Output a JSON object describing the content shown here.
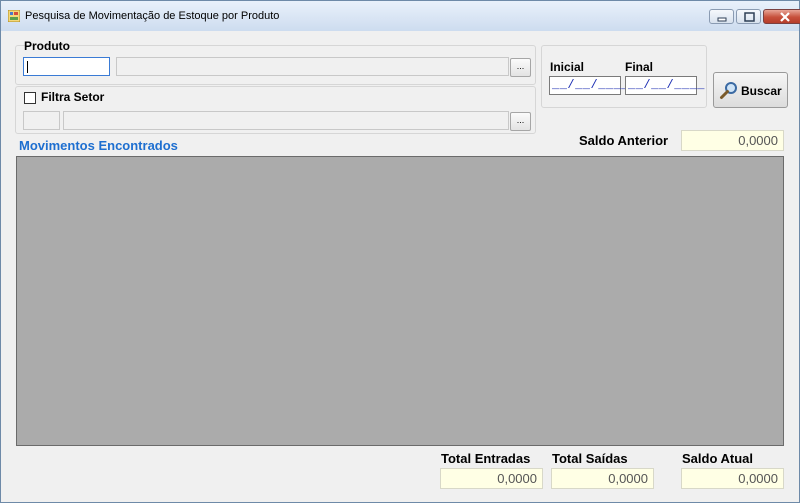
{
  "window": {
    "title": "Pesquisa de Movimentação de Estoque por Produto",
    "icons": [
      "app-icon",
      "minimize-icon",
      "maximize-icon",
      "close-icon"
    ]
  },
  "produto": {
    "label": "Produto",
    "code_value": "",
    "description_value": "",
    "lookup_label": "..."
  },
  "setor": {
    "checkbox_label": "Filtra Setor",
    "checked": false,
    "code_value": "",
    "description_value": "",
    "lookup_label": "..."
  },
  "periodo": {
    "inicial_label": "Inicial",
    "inicial_value": "__/__/____",
    "final_label": "Final",
    "final_value": "__/__/____"
  },
  "buscar": {
    "label": "Buscar",
    "icon": "magnifier-icon"
  },
  "saldo_anterior": {
    "label": "Saldo Anterior",
    "value": "0,0000"
  },
  "movimentos": {
    "title": "Movimentos Encontrados",
    "rows": []
  },
  "totais": {
    "entradas_label": "Total Entradas",
    "entradas_value": "0,0000",
    "saidas_label": "Total Saídas",
    "saidas_value": "0,0000",
    "saldo_atual_label": "Saldo Atual",
    "saldo_atual_value": "0,0000"
  },
  "colors": {
    "accent_title": "#1e6fd0",
    "grid_background": "#ababab",
    "readonly_field": "#ffffe5",
    "mask_text": "#1d2fb3"
  }
}
